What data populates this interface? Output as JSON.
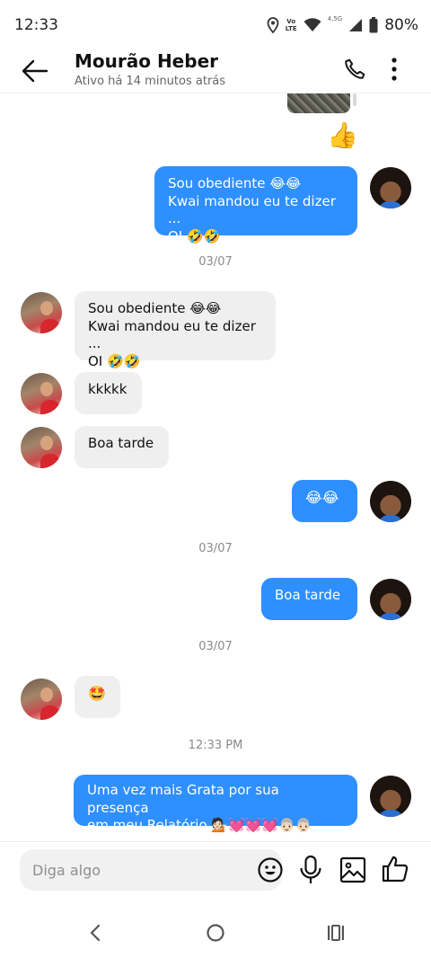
{
  "status_bar": {
    "time": "12:33",
    "volte_top": "Vo",
    "volte_bottom": "LTE",
    "network": "4,5G",
    "battery": "80%"
  },
  "header": {
    "contact_name": "Mourão Heber",
    "contact_status": "Ativo há 14 minutos atrás"
  },
  "conversation": {
    "top_emoji": "👍",
    "messages": [
      {
        "direction": "outgoing",
        "text": "Sou obediente 😂😂\nKwai mandou eu te dizer ...\nOI 🤣🤣"
      },
      {
        "direction": "separator",
        "text": "03/07"
      },
      {
        "direction": "incoming",
        "text": "Sou obediente 😂😂\nKwai mandou eu te dizer ...\nOI 🤣🤣"
      },
      {
        "direction": "incoming",
        "text": "kkkkk"
      },
      {
        "direction": "incoming",
        "text": "Boa tarde"
      },
      {
        "direction": "outgoing",
        "text": "😂😂"
      },
      {
        "direction": "separator",
        "text": "03/07"
      },
      {
        "direction": "outgoing",
        "text": "Boa tarde"
      },
      {
        "direction": "separator",
        "text": "03/07"
      },
      {
        "direction": "incoming",
        "text": "🤩"
      },
      {
        "direction": "separator",
        "text": "12:33 PM"
      },
      {
        "direction": "outgoing",
        "text": "Uma vez mais Grata por sua presença\nem meu Relatório 💁🏻💓💓💓👵🏻👵🏻"
      }
    ]
  },
  "composer": {
    "placeholder": "Diga algo",
    "value": ""
  },
  "icons": {
    "back": "arrow-left-icon",
    "call": "phone-icon",
    "more": "more-vertical-icon",
    "emoji": "smiley-icon",
    "mic": "microphone-icon",
    "image": "image-icon",
    "like": "thumbs-up-icon"
  },
  "colors": {
    "outgoing_bubble": "#2e8fff",
    "incoming_bubble": "#efefef"
  }
}
